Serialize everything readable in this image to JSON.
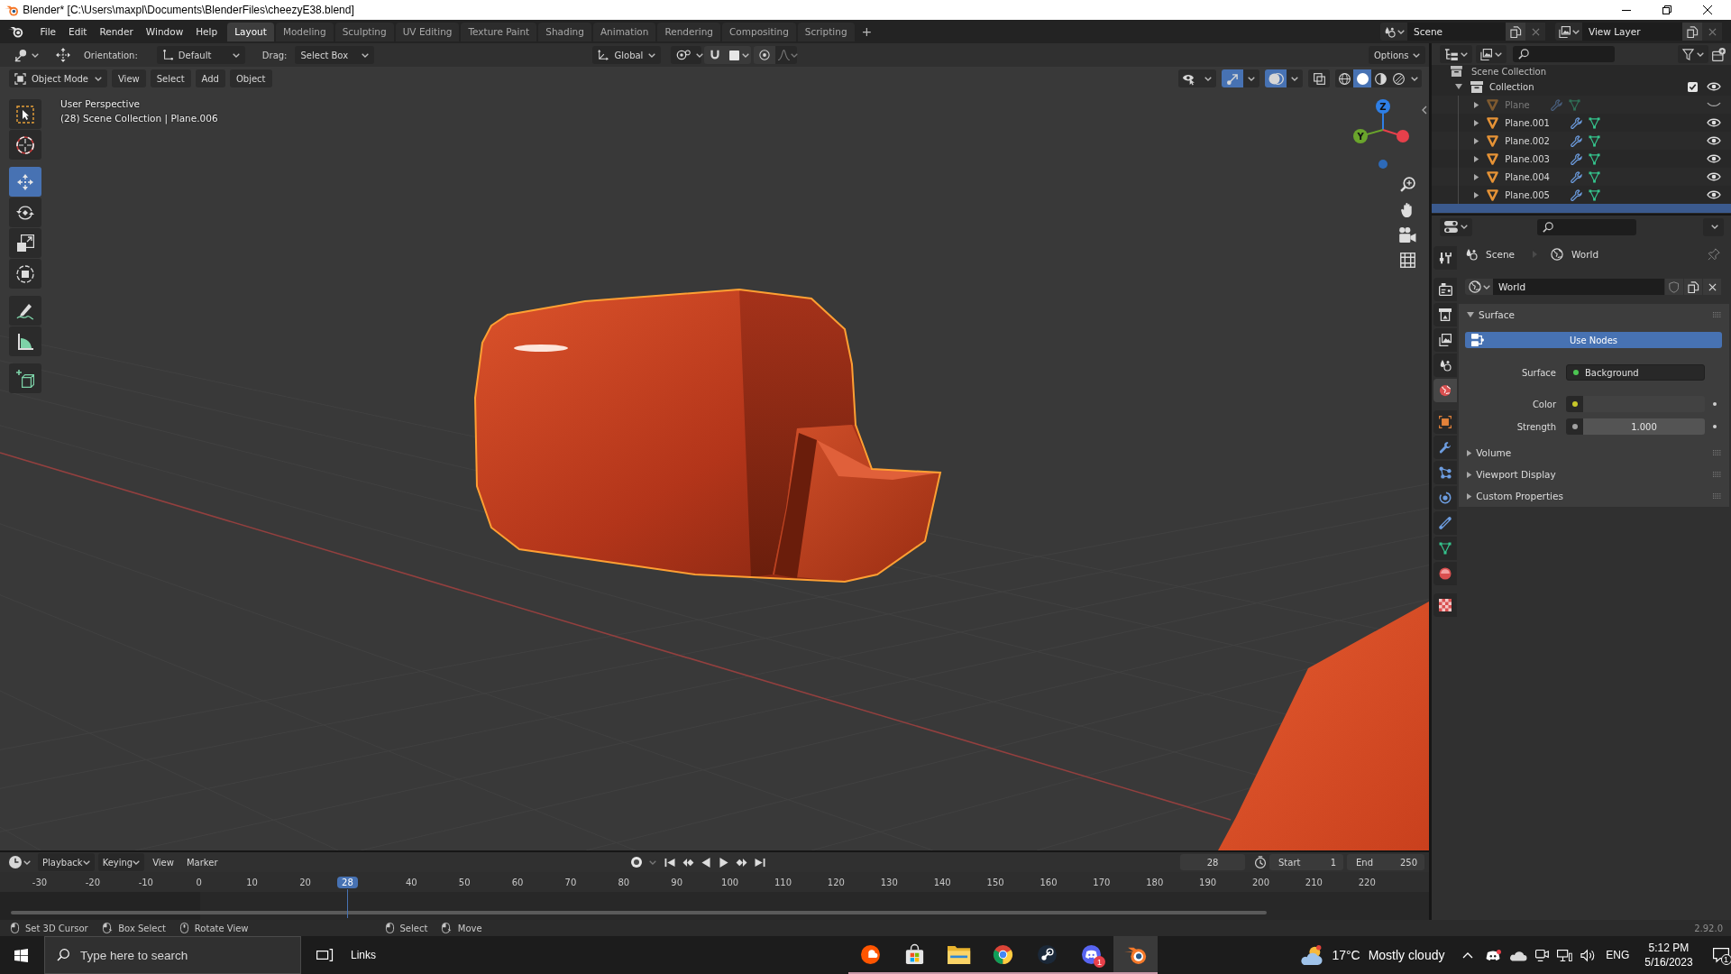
{
  "window": {
    "title": "Blender* [C:\\Users\\maxpl\\Documents\\BlenderFiles\\cheezyE38.blend]"
  },
  "top_bar": {
    "menus": [
      "File",
      "Edit",
      "Render",
      "Window",
      "Help"
    ],
    "workspace_tabs": [
      {
        "label": "Layout",
        "selected": true
      },
      {
        "label": "Modeling",
        "selected": false
      },
      {
        "label": "Sculpting",
        "selected": false
      },
      {
        "label": "UV Editing",
        "selected": false
      },
      {
        "label": "Texture Paint",
        "selected": false
      },
      {
        "label": "Shading",
        "selected": false
      },
      {
        "label": "Animation",
        "selected": false
      },
      {
        "label": "Rendering",
        "selected": false
      },
      {
        "label": "Compositing",
        "selected": false
      },
      {
        "label": "Scripting",
        "selected": false
      }
    ],
    "add_tab": "+",
    "scene": "Scene",
    "view_layer": "View Layer"
  },
  "tool_header": {
    "orientation_label": "Orientation:",
    "orientation": "Default",
    "drag_label": "Drag:",
    "drag": "Select Box",
    "transform_orientation": "Global",
    "options": "Options"
  },
  "viewport_header": {
    "mode": "Object Mode",
    "menus": [
      "View",
      "Select",
      "Add",
      "Object"
    ],
    "toggles": [
      {
        "kind": "visibility",
        "on": false
      },
      {
        "kind": "gizmos",
        "on": true
      },
      {
        "kind": "overlays",
        "on": true
      },
      {
        "kind": "xray",
        "on": false
      }
    ],
    "shading": [
      {
        "kind": "wireframe",
        "selected": false
      },
      {
        "kind": "solid",
        "selected": true
      },
      {
        "kind": "material",
        "selected": false
      },
      {
        "kind": "rendered",
        "selected": false
      }
    ]
  },
  "toolbar": [
    [
      {
        "kind": "select",
        "selected": false
      },
      {
        "kind": "cursor",
        "selected": false
      }
    ],
    [
      {
        "kind": "move",
        "selected": true
      },
      {
        "kind": "rotate",
        "selected": false
      },
      {
        "kind": "scale",
        "selected": false
      },
      {
        "kind": "transform",
        "selected": false
      }
    ],
    [
      {
        "kind": "annotate",
        "selected": false
      },
      {
        "kind": "measure",
        "selected": false
      }
    ],
    [
      {
        "kind": "add_cube",
        "selected": false
      }
    ]
  ],
  "viewport": {
    "view_name": "User Perspective",
    "info": "(28) Scene Collection | Plane.006",
    "gizmo_axes": [
      {
        "label": "Z",
        "color": "#2e7fe6"
      },
      {
        "label": "Y",
        "color": "#6aa42c"
      },
      {
        "color": "#e6404b"
      },
      {
        "color": "#2d6ab8"
      }
    ]
  },
  "timeline": {
    "menus": [
      {
        "kind": "dropdown",
        "label": "Playback"
      },
      {
        "kind": "dropdown",
        "label": "Keying"
      },
      {
        "kind": "menu",
        "label": "View"
      },
      {
        "kind": "menu",
        "label": "Marker"
      }
    ],
    "current_frame": "28",
    "start_label": "Start",
    "start": "1",
    "end_label": "End",
    "end": "250",
    "ruler": [
      {
        "kind": "tick",
        "label": "-30"
      },
      {
        "kind": "tick",
        "label": "-20"
      },
      {
        "kind": "tick",
        "label": "-10"
      },
      {
        "kind": "tick",
        "label": "0"
      },
      {
        "kind": "tick",
        "label": "10"
      },
      {
        "kind": "tick",
        "label": "20"
      },
      {
        "kind": "playhead",
        "label": "28"
      },
      {
        "kind": "tick",
        "label": "40"
      },
      {
        "kind": "tick",
        "label": "50"
      },
      {
        "kind": "tick",
        "label": "60"
      },
      {
        "kind": "tick",
        "label": "70"
      },
      {
        "kind": "tick",
        "label": "80"
      },
      {
        "kind": "tick",
        "label": "90"
      },
      {
        "kind": "tick",
        "label": "100"
      },
      {
        "kind": "tick",
        "label": "110"
      },
      {
        "kind": "tick",
        "label": "120"
      },
      {
        "kind": "tick",
        "label": "130"
      },
      {
        "kind": "tick",
        "label": "140"
      },
      {
        "kind": "tick",
        "label": "150"
      },
      {
        "kind": "tick",
        "label": "160"
      },
      {
        "kind": "tick",
        "label": "170"
      },
      {
        "kind": "tick",
        "label": "180"
      },
      {
        "kind": "tick",
        "label": "190"
      },
      {
        "kind": "tick",
        "label": "200"
      },
      {
        "kind": "tick",
        "label": "210"
      },
      {
        "kind": "tick",
        "label": "220"
      }
    ]
  },
  "status_bar": {
    "hint_groups": [
      [
        {
          "kind": "left",
          "label": "Set 3D Cursor"
        },
        {
          "kind": "drag",
          "label": "Box Select"
        },
        {
          "kind": "middle",
          "label": "Rotate View"
        }
      ],
      [
        {
          "kind": "left",
          "label": "Select"
        },
        {
          "kind": "drag",
          "label": "Move"
        }
      ]
    ],
    "version": "2.92.0"
  },
  "outliner": {
    "root": {
      "name": "Scene Collection",
      "children": [
        {
          "name": "Collection",
          "expanded": true,
          "checked": true,
          "visible": true,
          "children": [
            {
              "name": "Plane",
              "visible": false,
              "selected": false
            },
            {
              "name": "Plane.001",
              "visible": true,
              "selected": false
            },
            {
              "name": "Plane.002",
              "visible": true,
              "selected": false
            },
            {
              "name": "Plane.003",
              "visible": true,
              "selected": false
            },
            {
              "name": "Plane.004",
              "visible": true,
              "selected": false
            },
            {
              "name": "Plane.005",
              "visible": true,
              "selected": false
            },
            {
              "selected": true
            }
          ]
        }
      ]
    }
  },
  "properties": {
    "tabs": [
      [
        {
          "kind": "tool",
          "selected": false
        }
      ],
      [
        {
          "kind": "render",
          "selected": false
        },
        {
          "kind": "output",
          "selected": false
        },
        {
          "kind": "view_layer",
          "selected": false
        },
        {
          "kind": "scene",
          "selected": false
        },
        {
          "kind": "world",
          "selected": true
        }
      ],
      [
        {
          "kind": "object",
          "selected": false
        },
        {
          "kind": "modifiers",
          "selected": false
        },
        {
          "kind": "particles",
          "selected": false
        },
        {
          "kind": "physics",
          "selected": false
        },
        {
          "kind": "constraints",
          "selected": false
        },
        {
          "kind": "data",
          "selected": false
        },
        {
          "kind": "material",
          "selected": false
        }
      ],
      [
        {
          "kind": "texture",
          "selected": false
        }
      ]
    ],
    "breadcrumb": [
      {
        "kind": "scene",
        "label": "Scene"
      },
      {
        "kind": "world",
        "label": "World"
      }
    ],
    "datablock": "World",
    "panels": [
      {
        "title": "Surface",
        "expanded": true,
        "button": "Use Nodes",
        "fields": [
          {
            "kind": "shader",
            "label": "Surface",
            "value": "Background",
            "color": "#4cc552"
          },
          {
            "kind": "color",
            "label": "Color",
            "color": "#c7c729"
          },
          {
            "kind": "number",
            "label": "Strength",
            "value": "1.000",
            "color": "#a1a1a1"
          }
        ]
      },
      {
        "title": "Volume",
        "expanded": false
      },
      {
        "title": "Viewport Display",
        "expanded": false
      },
      {
        "title": "Custom Properties",
        "expanded": false
      }
    ]
  },
  "taskbar": {
    "search": {
      "placeholder": "Type here to search"
    },
    "toolbar": "Links",
    "apps": [
      {
        "kind": "soundcloud",
        "active": false
      },
      {
        "kind": "store",
        "active": false
      },
      {
        "kind": "explorer",
        "active": false
      },
      {
        "kind": "chrome",
        "active": false
      },
      {
        "kind": "steam",
        "active": false
      },
      {
        "kind": "discord",
        "active": false,
        "badge": "1"
      },
      {
        "kind": "blender",
        "active": true
      }
    ],
    "weather": {
      "temperature": "17°C",
      "condition": "Mostly cloudy"
    },
    "tray": [
      {
        "kind": "chevron"
      },
      {
        "kind": "discord"
      },
      {
        "kind": "cloud"
      },
      {
        "kind": "meet"
      },
      {
        "kind": "network"
      },
      {
        "kind": "volume"
      }
    ],
    "language": "ENG",
    "time": "5:12 PM",
    "date": "5/16/2023",
    "notifications": "1"
  }
}
